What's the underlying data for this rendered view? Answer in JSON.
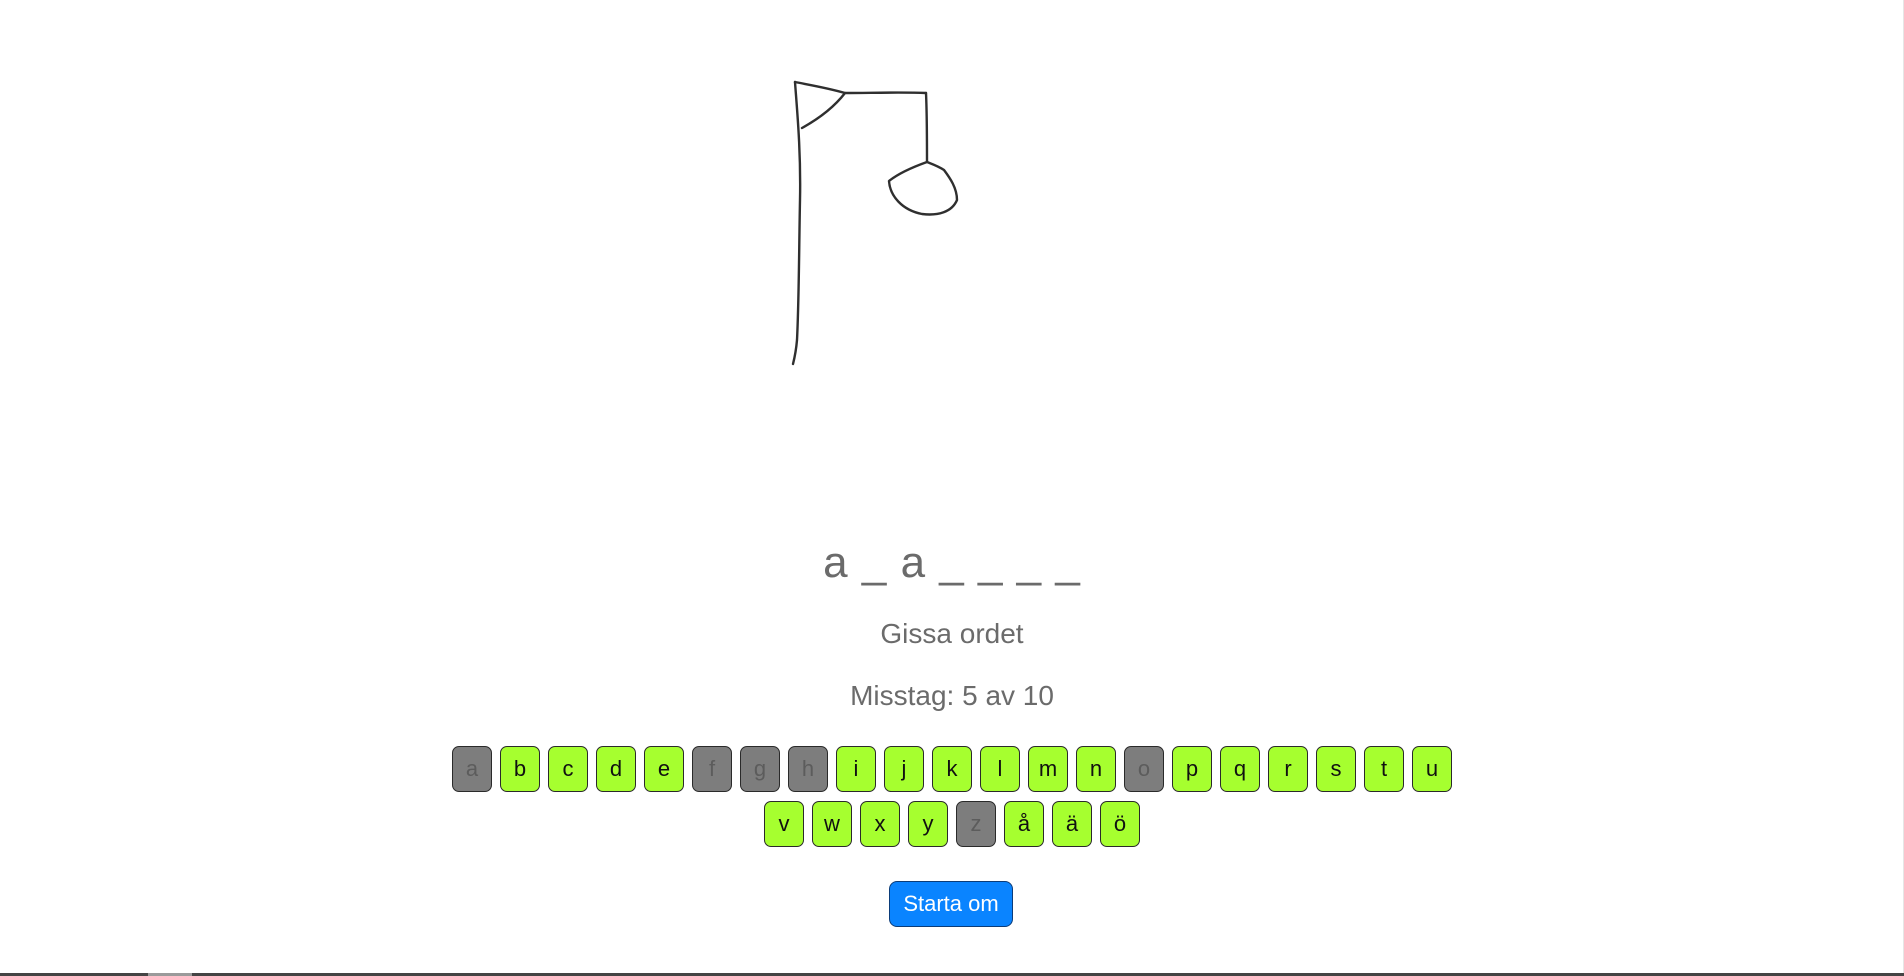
{
  "game": {
    "word_display": "a _ a _ _ _ _",
    "prompt": "Gissa ordet",
    "mistakes_text": "Misstag: 5 av 10",
    "mistakes": 5,
    "max_mistakes": 10
  },
  "keyboard": {
    "row1": [
      {
        "letter": "a",
        "used": true
      },
      {
        "letter": "b",
        "used": false
      },
      {
        "letter": "c",
        "used": false
      },
      {
        "letter": "d",
        "used": false
      },
      {
        "letter": "e",
        "used": false
      },
      {
        "letter": "f",
        "used": true
      },
      {
        "letter": "g",
        "used": true
      },
      {
        "letter": "h",
        "used": true
      },
      {
        "letter": "i",
        "used": false
      },
      {
        "letter": "j",
        "used": false
      },
      {
        "letter": "k",
        "used": false
      },
      {
        "letter": "l",
        "used": false
      },
      {
        "letter": "m",
        "used": false
      },
      {
        "letter": "n",
        "used": false
      },
      {
        "letter": "o",
        "used": true
      },
      {
        "letter": "p",
        "used": false
      },
      {
        "letter": "q",
        "used": false
      },
      {
        "letter": "r",
        "used": false
      },
      {
        "letter": "s",
        "used": false
      },
      {
        "letter": "t",
        "used": false
      },
      {
        "letter": "u",
        "used": false
      }
    ],
    "row2": [
      {
        "letter": "v",
        "used": false
      },
      {
        "letter": "w",
        "used": false
      },
      {
        "letter": "x",
        "used": false
      },
      {
        "letter": "y",
        "used": false
      },
      {
        "letter": "z",
        "used": true
      },
      {
        "letter": "å",
        "used": false
      },
      {
        "letter": "ä",
        "used": false
      },
      {
        "letter": "ö",
        "used": false
      }
    ]
  },
  "restart_label": "Starta om",
  "colors": {
    "key_available": "#a6ff2f",
    "key_used": "#7d7d7d",
    "restart": "#0a84ff",
    "text": "#6b6b6b"
  }
}
